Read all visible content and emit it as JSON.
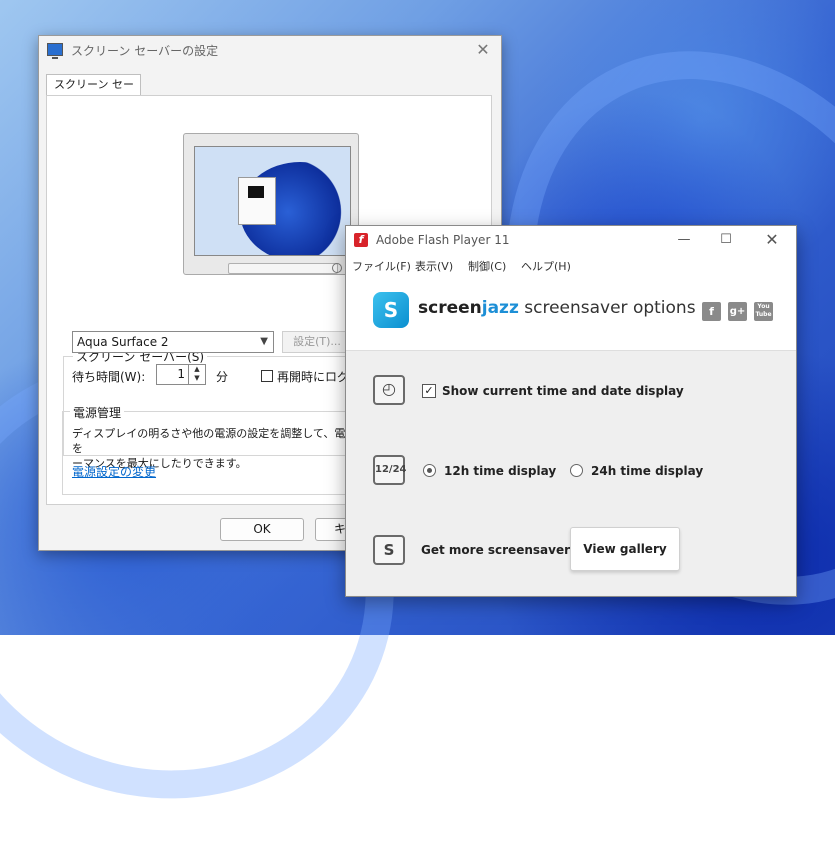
{
  "screensaver_dialog": {
    "title": "スクリーン セーバーの設定",
    "tab": "スクリーン セーバー",
    "group_label": "スクリーン セーバー(S)",
    "selected_screensaver": "Aqua Surface 2",
    "settings_button": "設定(T)...",
    "wait_label": "待ち時間(W):",
    "wait_value": "1",
    "wait_unit": "分",
    "resume_checkbox_label": "再開時にログオ",
    "resume_checked": false,
    "power_group_label": "電源管理",
    "power_description": "ディスプレイの明るさや他の電源の設定を調整して、電力を",
    "power_description_2": "ーマンスを最大にしたりできます。",
    "power_link": "電源設定の変更",
    "ok_button": "OK",
    "cancel_button": "キ"
  },
  "flash_window": {
    "title": "Adobe Flash Player 11",
    "menu": [
      "ファイル(F)",
      "表示(V)",
      "制御(C)",
      "ヘルプ(H)"
    ],
    "brand_bold": "screen",
    "brand_accent": "jazz",
    "brand_rest": " screensaver options",
    "social": [
      "f",
      "g+",
      "You Tube"
    ],
    "show_time_label": "Show current time and date display",
    "show_time_checked": true,
    "time_format_icon": "12/24",
    "radio_12h": "12h time display",
    "radio_24h": "24h time display",
    "selected_format": "12h",
    "get_more_label": "Get more screensavers",
    "view_gallery_button": "View gallery"
  },
  "icons": {
    "clock": "clock-icon",
    "logo": "screenjazz-logo-icon",
    "flash": "flash-icon"
  },
  "colors": {
    "flash_red": "#d8232a",
    "screenjazz_blue": "#1d8fd6",
    "link": "#0066cc"
  }
}
